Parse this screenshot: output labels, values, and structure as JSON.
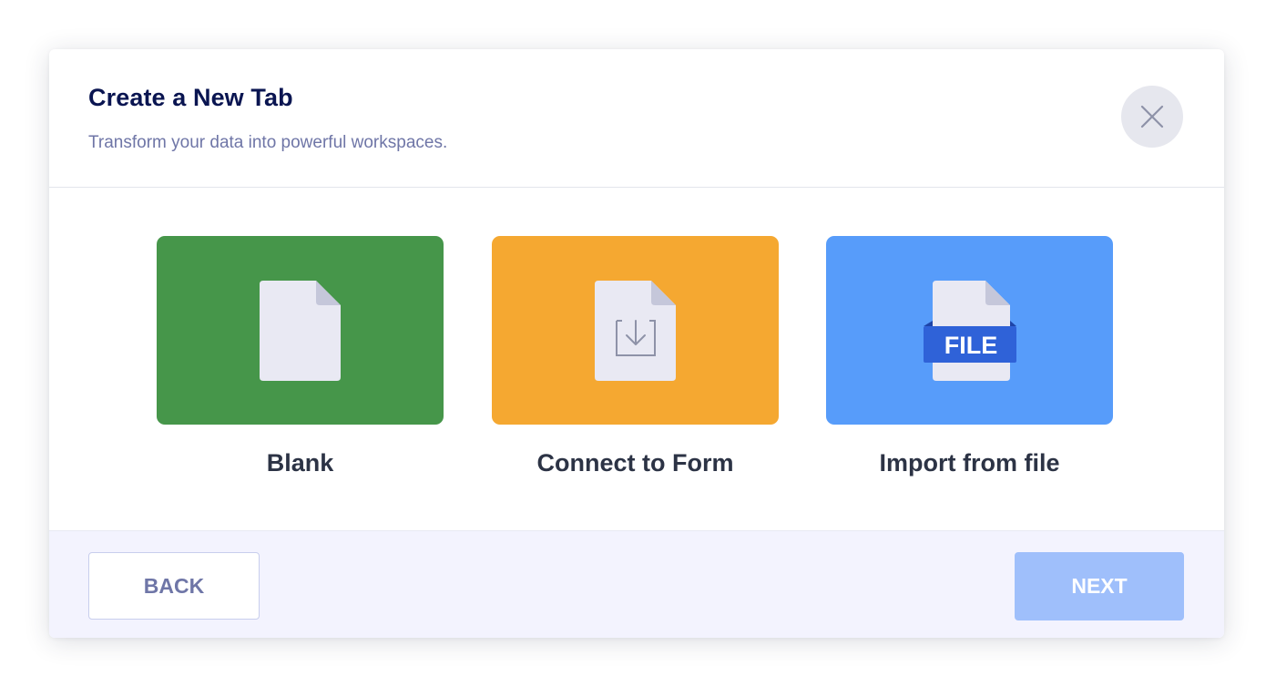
{
  "header": {
    "title": "Create a New Tab",
    "subtitle": "Transform your data into powerful workspaces."
  },
  "close_button": {
    "icon": "close-icon"
  },
  "options": [
    {
      "label": "Blank",
      "icon": "blank-document-icon",
      "color": "#46964a"
    },
    {
      "label": "Connect to Form",
      "icon": "form-import-icon",
      "color": "#f5a831"
    },
    {
      "label": "Import from file",
      "icon": "file-icon",
      "icon_text": "FILE",
      "color": "#579cfa"
    }
  ],
  "footer": {
    "back_label": "BACK",
    "next_label": "NEXT"
  },
  "colors": {
    "title": "#0a1551",
    "subtitle": "#6f76a7",
    "footer_bg": "#f3f3fe",
    "next_button": "#9fbffb",
    "file_badge": "#2f62d8"
  }
}
